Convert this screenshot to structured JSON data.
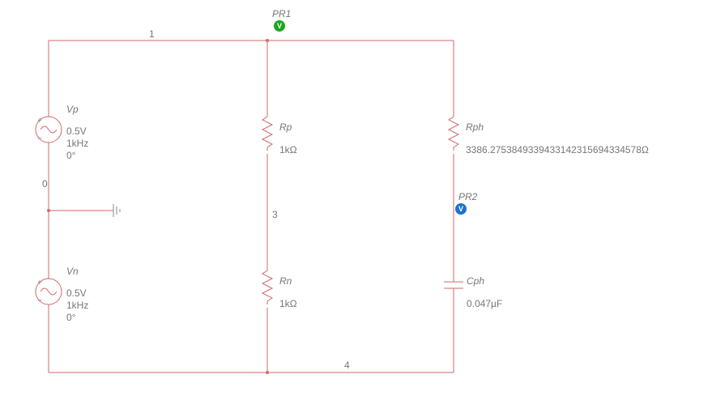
{
  "probes": {
    "pr1": {
      "label": "PR1",
      "glyph": "V"
    },
    "pr2": {
      "label": "PR2",
      "glyph": "V"
    }
  },
  "nodes": {
    "n0": "0",
    "n1": "1",
    "n3": "3",
    "n4": "4"
  },
  "components": {
    "Vp": {
      "name": "Vp",
      "amplitude": "0.5V",
      "freq": "1kHz",
      "phase": "0°",
      "plus": "+",
      "minus": "−"
    },
    "Vn": {
      "name": "Vn",
      "amplitude": "0.5V",
      "freq": "1kHz",
      "phase": "0°",
      "plus": "+",
      "minus": "−"
    },
    "Rp": {
      "name": "Rp",
      "value": "1kΩ"
    },
    "Rn": {
      "name": "Rn",
      "value": "1kΩ"
    },
    "Rph": {
      "name": "Rph",
      "value": "3386.2753849339433142315694334578Ω"
    },
    "Cph": {
      "name": "Cph",
      "value": "0.047µF"
    }
  }
}
